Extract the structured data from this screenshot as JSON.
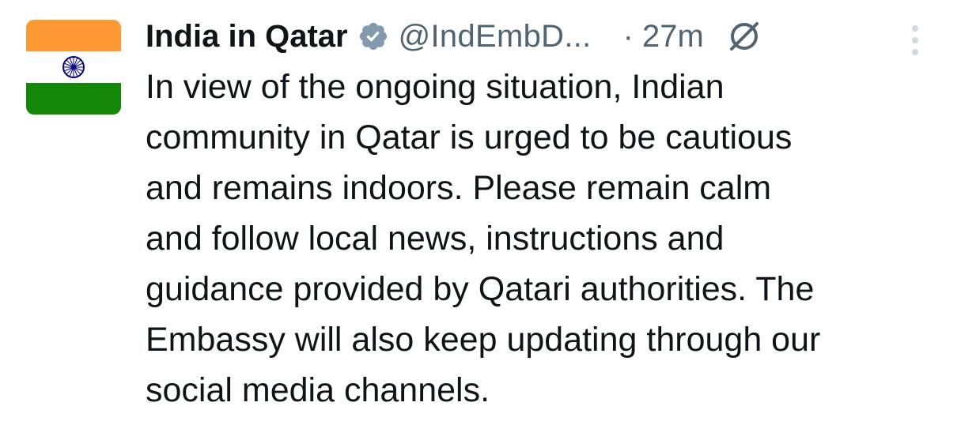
{
  "tweet": {
    "display_name": "India in Qatar",
    "handle": "@IndEmbD...",
    "time": "· 27m",
    "text_lines": [
      "In view of the ongoing situation, Indian",
      "community in Qatar is urged to be cautious",
      "and remains indoors. Please remain calm",
      "and follow local news, instructions and",
      "guidance provided by Qatari authorities. The",
      "Embassy will also keep updating through our",
      "social media channels."
    ]
  },
  "icons": {
    "verified": "verified-badge-icon",
    "grok": "grok-icon",
    "more": "more-options-icon",
    "avatar": "india-flag-avatar"
  },
  "colors": {
    "text": "#0f1419",
    "secondary": "#536471",
    "verified_badge": "#829aab",
    "flag_saffron": "#ff9933",
    "flag_white": "#ffffff",
    "flag_green": "#138808",
    "chakra_navy": "#000080"
  }
}
